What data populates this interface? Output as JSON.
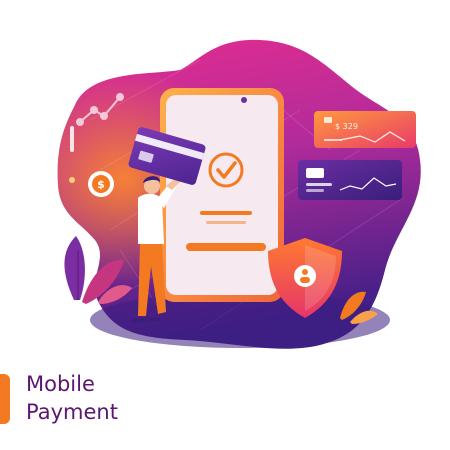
{
  "caption": {
    "line1": "Mobile",
    "line2": "Payment"
  },
  "card": {
    "amount": "$ 329"
  },
  "icons": [
    "dollar-coin-icon",
    "checkmark-icon",
    "shield-user-icon",
    "line-chart-icon",
    "bar-chart-icon",
    "credit-card-icon"
  ],
  "colors": {
    "blob_top": "#e42d8f",
    "blob_mid": "#9b2a9f",
    "blob_bottom": "#4a1f8a",
    "accent_orange": "#f47a21",
    "caption_text": "#5b1670",
    "phone_frame": "#f39c45",
    "phone_screen": "#f6e9ef"
  }
}
